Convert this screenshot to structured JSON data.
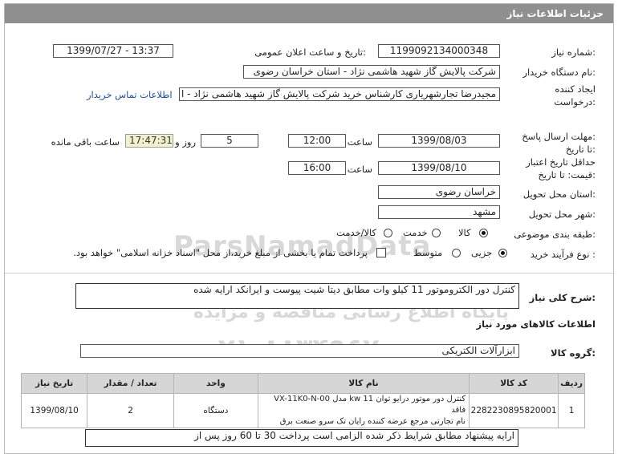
{
  "header": {
    "title": "جزئیات اطلاعات نیاز"
  },
  "form": {
    "need_number_label": "شماره نیاز:",
    "need_number": "1199092134000348",
    "announce_label": "تاریخ و ساعت اعلان عمومی:",
    "announce_value": "1399/07/27 - 13:37",
    "buyer_label": "نام دستگاه خریدار:",
    "buyer_value": "شرکت پالایش گاز شهید هاشمی نژاد - استان خراسان رضوی",
    "creator_label_1": "ایجاد کننده",
    "creator_label_2": "درخواست:",
    "creator_value": "مجیدرضا تجارشهریاری کارشناس خرید شرکت پالایش گاز شهید هاشمی نژاد - ا",
    "contact_link": "اطلاعات تماس خریدار",
    "deadline_label_1": "مهلت ارسال پاسخ:",
    "deadline_label_2": "تا تاریخ:",
    "deadline_date": "1399/08/03",
    "time_label": "ساعت",
    "deadline_time": "12:00",
    "days_value": "5",
    "days_label": "روز و",
    "remaining_time": "17:47:31",
    "remaining_label": "ساعت باقی مانده",
    "validity_label_1": "حداقل تاریخ اعتبار",
    "validity_label_2": "قیمت: تا تاریخ:",
    "validity_date": "1399/08/10",
    "validity_time": "16:00",
    "province_label": "استان محل تحویل:",
    "province_value": "خراسان رضوی",
    "city_label": "شهر محل تحویل:",
    "city_value": "مشهد",
    "category_label": "طبقه بندی موضوعی:",
    "category_options": [
      "کالا",
      "خدمت",
      "کالا/خدمت"
    ],
    "process_label": "نوع فرآیند خرید :",
    "process_options": [
      "جزیی",
      "متوسط"
    ],
    "payment_note": "پرداخت تمام یا بخشی از مبلغ خرید،از محل \"اسناد خزانه اسلامی\" خواهد بود."
  },
  "description": {
    "label": "شرح کلی نیاز:",
    "value": "کنترل دور الکتروموتور 11 کیلو وات مطابق دیتا شیت پیوست و ایرانکد ارایه شده"
  },
  "goods": {
    "section_title": "اطلاعات کالاهای مورد نیاز",
    "group_label": "گروه کالا:",
    "group_value": "ابزارآلات الکتریکی",
    "columns": [
      "ردیف",
      "کد کالا",
      "نام کالا",
      "واحد",
      "تعداد / مقدار",
      "تاریخ نیاز"
    ],
    "rows": [
      {
        "index": "1",
        "code": "2282230895820001",
        "name_line1": "کنترل دور موتور درایو توان kw 11 مدل VX-11K0-N-00 فاقد",
        "name_line2": "نام تجارتی مرجع عرضه کننده رایان تک سرو صنعت برق",
        "unit": "دستگاه",
        "qty": "2",
        "date": "1399/08/10"
      }
    ]
  },
  "footer_text": "ارایه پیشنهاد مطابق شرایط ذکر شده الزامی است پرداخت 30 تا 60 روز پس از",
  "watermark": {
    "brand": "ParsNamadData",
    "line1": "پایگاه اطلاع رسانی مناقصه و مزایده",
    "phone": "۰۲۱-۸۸۳۴۹۶۷۰"
  },
  "colors": {
    "titlebar": "#8f8f8f",
    "link": "#1a4fa8",
    "timer_bg": "#f4f0cc",
    "table_header": "#d6d6d6"
  }
}
